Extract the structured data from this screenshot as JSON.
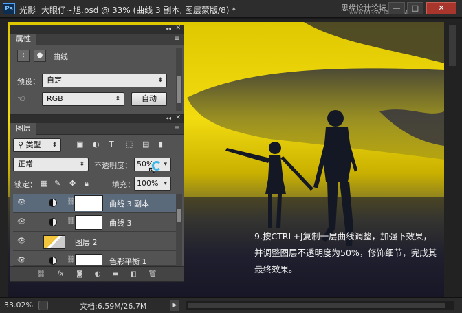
{
  "titlebar": {
    "logo": "Ps",
    "app_name": "光影",
    "document": "大眼仔~旭.psd @ 33% (曲线 3 副本, 图层蒙版/8) *",
    "watermark": "思缘设计论坛",
    "watermark_url": "www.MISSVUAN.COM",
    "min": "—",
    "max": "□",
    "close": "✕"
  },
  "properties_panel": {
    "tab": "属性",
    "title": "曲线",
    "preset_label": "预设：",
    "preset_value": "自定",
    "channel_value": "RGB",
    "auto_button": "自动"
  },
  "layers_panel": {
    "tab": "图层",
    "filter_type": "类型",
    "blend_mode": "正常",
    "opacity_label": "不透明度：",
    "opacity_value": "50%",
    "lock_label": "锁定：",
    "fill_label": "填充：",
    "fill_value": "100%",
    "layers": [
      {
        "name": "曲线 3 副本",
        "kind": "adjustment",
        "selected": true
      },
      {
        "name": "曲线 3",
        "kind": "adjustment",
        "selected": false
      },
      {
        "name": "图层 2",
        "kind": "pixel",
        "selected": false
      },
      {
        "name": "色彩平衡 1",
        "kind": "adjustment",
        "selected": false
      }
    ],
    "footer_icons": [
      "link-icon",
      "fx-icon",
      "mask-icon",
      "adjustment-icon",
      "folder-icon",
      "new-layer-icon",
      "trash-icon"
    ]
  },
  "caption": "9.按CTRL+J复制一层曲线调整，加强下效果，并调整图层不透明度为50%，修饰细节，完成其最终效果。",
  "statusbar": {
    "zoom": "33.02%",
    "doc_size": "文档:6.59M/26.7M",
    "arrow": "▶"
  },
  "colors": {
    "sky_yellow": "#f0d800",
    "panel": "#535353",
    "selected_layer": "#5a6a7a"
  }
}
